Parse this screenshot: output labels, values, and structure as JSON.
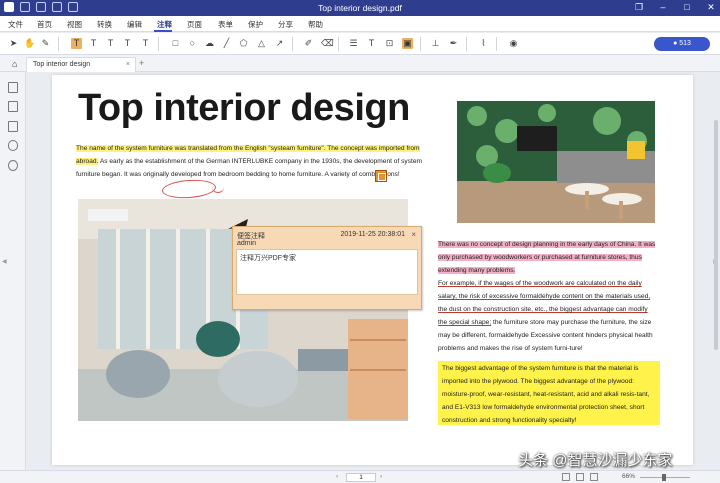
{
  "window": {
    "title": "Top interior design.pdf"
  },
  "menu": [
    "文件",
    "首页",
    "视图",
    "转换",
    "编辑",
    "注释",
    "页面",
    "表单",
    "保护",
    "分享",
    "帮助"
  ],
  "menu_active": "注释",
  "toolbar": {
    "login_label": "513"
  },
  "tabs": [
    {
      "label": "Top interior design"
    }
  ],
  "document": {
    "title": "Top interior design",
    "para1_highlight": "The name of the system furniture was translated from the English \"systeam furniture\". The concept was imported from abroad.",
    "para1_rest_a": " As early as the establishment of the German INTERLUBKE company in the 1930s, the development of system furniture began. It was originally developed from bedroom bedding to home furniture. A variety of ",
    "para1_circled": "combinations",
    "para1_rest_b": "!",
    "right_pink": "There was no concept of design planning in the early days of China. It was only purchased by woodworkers or purchased at furniture stores, thus extending many problems.",
    "right_underlined": "For example, if the wages of the woodwork are calculated on the daily salary, the risk of excessive formaldehyde content on the materials used, the dust on the construction site, etc., the biggest advantage can modify the special shape;",
    "right_plain": " the furniture store may purchase the furniture, the size may be different, formaldehyde Excessive content hinders physical health problems and makes the rise of system furni-ture!",
    "yellow_para": "The biggest advantage of the system furniture is that the material is imported into the plywood. The biggest advantage of the plywood: moisture-proof, wear-resistant, heat-resistant, acid and alkali resis-tant, and E1-V313 low formaldehyde environmental protection sheet, short construction and strong functionality specialty!"
  },
  "sticky_note": {
    "title": "便签注释",
    "author": "admin",
    "date": "2019-11-25 20:38:01",
    "close": "×",
    "body": "注释万兴PDF专家"
  },
  "status": {
    "page": "1",
    "zoom": "66%"
  },
  "watermark": "头条 @智慧沙漏少东家",
  "colors": {
    "titlebar": "#2f3d8f",
    "highlight_yellow": "#fff27a",
    "highlight_pink": "#f2b1c6",
    "sticky": "#f8d9b6",
    "accent": "#3a56cc"
  }
}
